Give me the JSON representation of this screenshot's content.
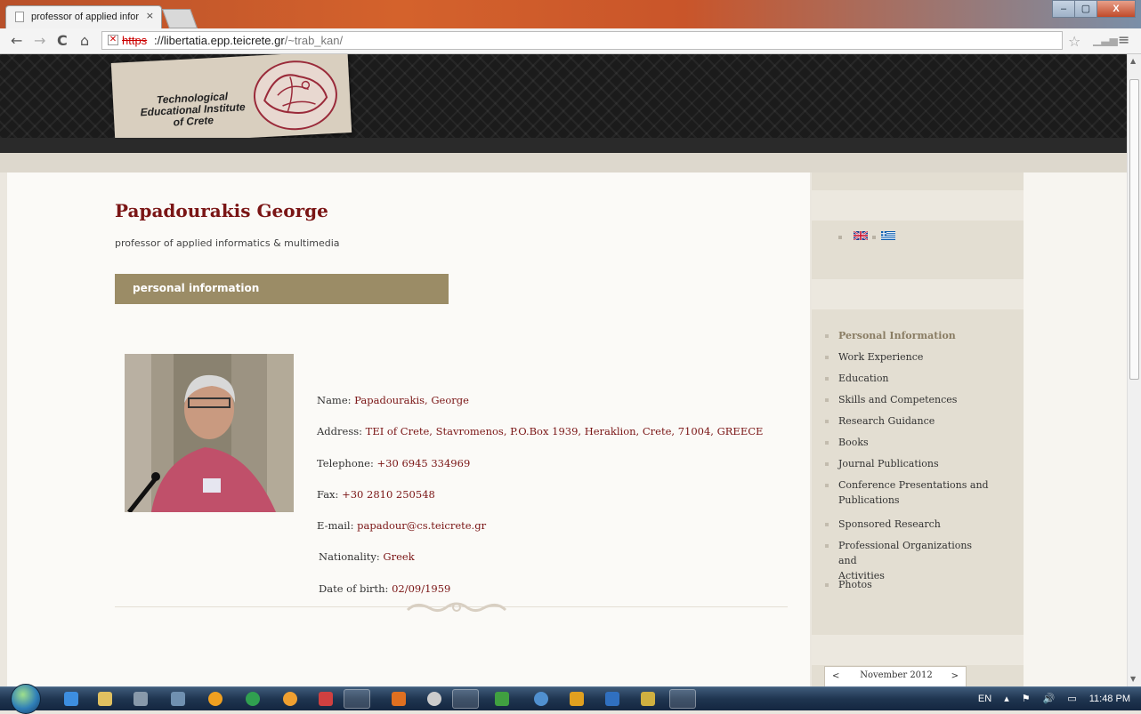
{
  "browser": {
    "tab_title": "professor of applied infor",
    "tab_close": "×",
    "url_scheme": "https",
    "url_host": "://libertatia.epp.teicrete.gr",
    "url_path": "/~trab_kan/",
    "window_controls": [
      "–",
      "▢",
      "X"
    ]
  },
  "header": {
    "logo_text_line1": "Technological",
    "logo_text_line2": "Educational Institute",
    "logo_text_line3": "of Crete"
  },
  "profile": {
    "name": "Papadourakis George",
    "subtitle": "professor of applied informatics & multimedia",
    "section_title": "personal information",
    "fields": [
      {
        "label": "Name: ",
        "value": "Papadourakis, George"
      },
      {
        "label": "Address:  ",
        "value": "TEI of Crete, Stavromenos, P.O.Box 1939,  Heraklion, Crete, 71004, GREECE"
      },
      {
        "label": "Telephone:  ",
        "value": "+30 6945 334969"
      },
      {
        "label": "Fax:  ",
        "value": "+30 2810 250548"
      },
      {
        "label": "E-mail:  ",
        "value": "papadour@cs.teicrete.gr"
      },
      {
        "label": "Nationality: ",
        "value": "Greek"
      },
      {
        "label": "Date of birth: ",
        "value": "02/09/1959"
      }
    ]
  },
  "sidebar": {
    "languages": [
      "english-flag-icon",
      "greek-flag-icon"
    ],
    "menu": [
      {
        "label": "Personal Information",
        "active": true
      },
      {
        "label": "Work Experience"
      },
      {
        "label": "Education"
      },
      {
        "label": "Skills and Competences"
      },
      {
        "label": "Research Guidance"
      },
      {
        "label": "Books"
      },
      {
        "label": "Journal Publications"
      },
      {
        "label": "Conference Presentations and",
        "label2": "Publications"
      },
      {
        "label": "Sponsored Research"
      },
      {
        "label": "Professional Organizations and",
        "label2": "Activities"
      },
      {
        "label": "Photos"
      }
    ],
    "calendar": {
      "prev": "<",
      "month": "November 2012",
      "next": ">"
    }
  },
  "taskbar": {
    "lang": "EN",
    "time": "11:48 PM"
  },
  "colors": {
    "accent_dark_red": "#7a1515",
    "section_bar": "#9b8c66",
    "sidebar_bg": "#e3ded2"
  }
}
